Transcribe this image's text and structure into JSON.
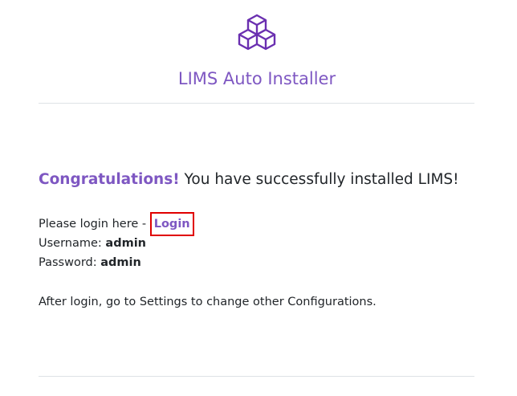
{
  "header": {
    "icon": "cubes-icon",
    "title": "LIMS Auto Installer"
  },
  "colors": {
    "accent": "#7e57c2",
    "highlight_border": "#e00000",
    "divider": "#dee2e6"
  },
  "main": {
    "congrats_label": "Congratulations!",
    "congrats_text": " You have successfully installed LIMS!",
    "login_prefix": "Please login here - ",
    "login_link": "Login",
    "username_label": "Username: ",
    "username_value": "admin",
    "password_label": "Password: ",
    "password_value": "admin",
    "after_login_note": "After login, go to Settings to change other Configurations."
  }
}
